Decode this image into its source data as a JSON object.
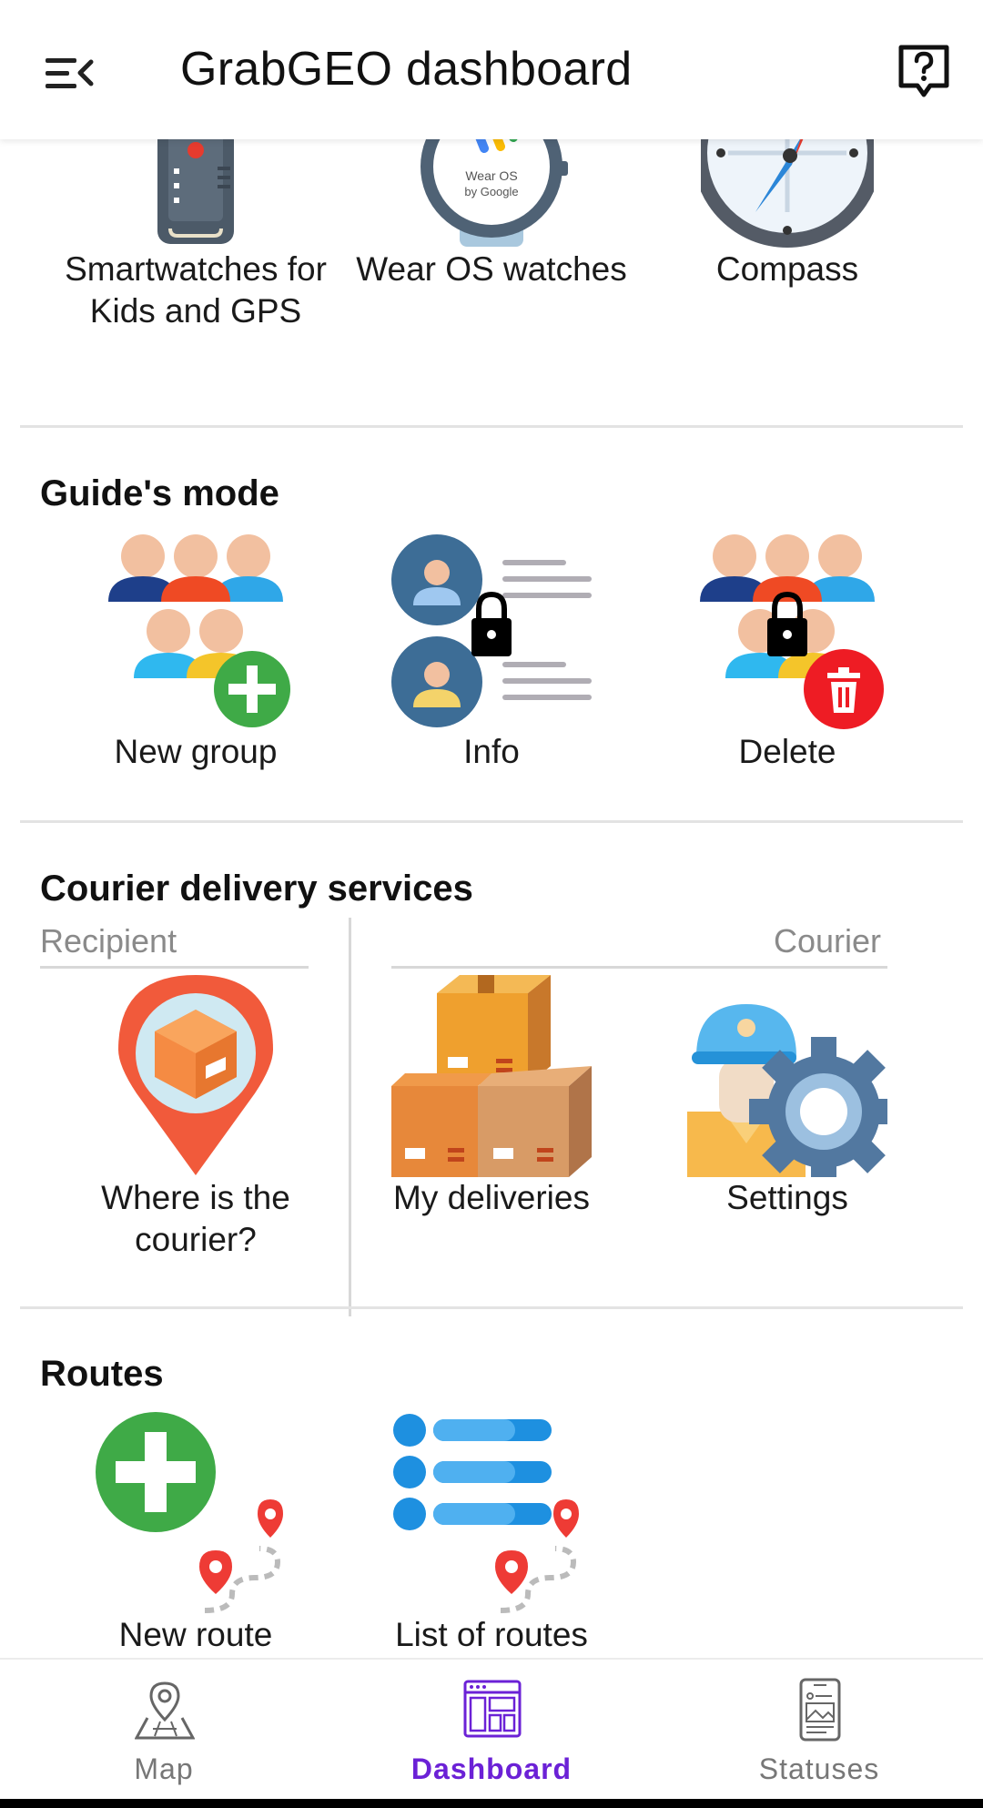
{
  "app": {
    "title": "GrabGEO dashboard"
  },
  "top_row": {
    "items": [
      {
        "label": "Smartwatches for Kids and GPS",
        "icon": "kids-smartwatch-icon"
      },
      {
        "label": "Wear OS watches",
        "icon": "wear-os-watch-icon",
        "badge_text": "Wear OS by Google"
      },
      {
        "label": "Compass",
        "icon": "compass-icon"
      }
    ]
  },
  "guide": {
    "title": "Guide's mode",
    "items": [
      {
        "label": "New group",
        "icon": "new-group-icon"
      },
      {
        "label": "Info",
        "icon": "group-info-icon",
        "locked": true
      },
      {
        "label": "Delete",
        "icon": "delete-group-icon",
        "locked": true
      }
    ]
  },
  "courier": {
    "title": "Courier delivery services",
    "recipient_label": "Recipient",
    "courier_label": "Courier",
    "items": [
      {
        "label": "Where is the courier?",
        "icon": "courier-location-pin-icon"
      },
      {
        "label": "My deliveries",
        "icon": "boxes-icon"
      },
      {
        "label": "Settings",
        "icon": "courier-settings-icon"
      }
    ]
  },
  "routes": {
    "title": "Routes",
    "items": [
      {
        "label": "New route",
        "icon": "new-route-icon"
      },
      {
        "label": "List of routes",
        "icon": "list-of-routes-icon"
      }
    ]
  },
  "bottom_nav": {
    "items": [
      {
        "label": "Map",
        "icon": "map-icon",
        "active": false
      },
      {
        "label": "Dashboard",
        "icon": "dashboard-icon",
        "active": true
      },
      {
        "label": "Statuses",
        "icon": "statuses-icon",
        "active": false
      }
    ]
  },
  "colors": {
    "accent": "#6b21d6",
    "divider": "#e3e3e3",
    "muted_text": "#8a8a8a"
  }
}
